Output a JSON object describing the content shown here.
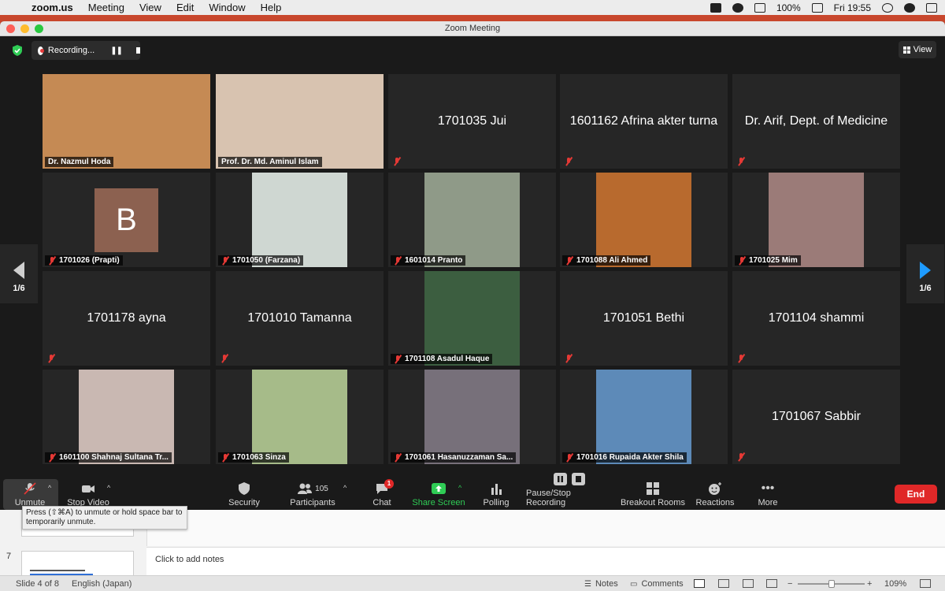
{
  "menubar": {
    "app": "zoom.us",
    "items": [
      "Meeting",
      "View",
      "Edit",
      "Window",
      "Help"
    ],
    "battery": "100%",
    "clock": "Fri 19:55"
  },
  "window": {
    "title": "Zoom Meeting"
  },
  "recording": {
    "label": "Recording..."
  },
  "view_button": {
    "label": "View"
  },
  "pager": {
    "left": "1/6",
    "right": "1/6"
  },
  "participants": [
    {
      "name": "Dr. Nazmul Hoda",
      "video": true,
      "muted": false,
      "active": true,
      "bg": "#c58a54"
    },
    {
      "name": "Prof. Dr. Md. Aminul Islam",
      "video": true,
      "muted": false,
      "bg": "#d8c3b0"
    },
    {
      "name": "1701035 Jui",
      "video": false,
      "muted": true
    },
    {
      "name": "1601162 Afrina akter turna",
      "video": false,
      "muted": true
    },
    {
      "name": "Dr. Arif, Dept. of Medicine",
      "video": false,
      "muted": true
    },
    {
      "name": "1701026 (Prapti)",
      "avatar": "B",
      "muted": true
    },
    {
      "name": "1701050 (Farzana)",
      "photo": true,
      "muted": true,
      "bg": "#cfd7d2"
    },
    {
      "name": "1601014 Pranto",
      "photo": true,
      "muted": true,
      "bg": "#8f9a88"
    },
    {
      "name": "1701088 Ali Ahmed",
      "photo": true,
      "muted": true,
      "bg": "#b86a2e"
    },
    {
      "name": "1701025 Mim",
      "photo": true,
      "muted": true,
      "bg": "#9b7b78"
    },
    {
      "name": "1701178 ayna",
      "video": false,
      "muted": true
    },
    {
      "name": "1701010 Tamanna",
      "video": false,
      "muted": true
    },
    {
      "name": "1701108 Asadul Haque",
      "photo": true,
      "muted": true,
      "bg": "#3c5e40"
    },
    {
      "name": "1701051 Bethi",
      "video": false,
      "muted": true
    },
    {
      "name": "1701104 shammi",
      "video": false,
      "muted": true
    },
    {
      "name": "1601100 Shahnaj Sultana Tr...",
      "photo": true,
      "muted": true,
      "bg": "#c9b8b2"
    },
    {
      "name": "1701063 Sinza",
      "photo": true,
      "muted": true,
      "bg": "#a6bb89"
    },
    {
      "name": "1701061 Hasanuzzaman Sa...",
      "photo": true,
      "muted": true,
      "bg": "#77707a"
    },
    {
      "name": "1701016 Rupaida Akter Shila",
      "photo": true,
      "muted": true,
      "bg": "#5d8ab8"
    },
    {
      "name": "1701067 Sabbir",
      "video": false,
      "muted": true
    }
  ],
  "toolbar": {
    "unmute": "Unmute",
    "stop_video": "Stop Video",
    "security": "Security",
    "participants": "Participants",
    "participants_count": "105",
    "chat": "Chat",
    "chat_badge": "1",
    "share_screen": "Share Screen",
    "polling": "Polling",
    "pause_stop_recording": "Pause/Stop Recording",
    "breakout_rooms": "Breakout Rooms",
    "reactions": "Reactions",
    "more": "More",
    "end": "End"
  },
  "tooltip": {
    "text": "Press  (⇧⌘A) to unmute or hold space bar to temporarily unmute."
  },
  "powerpoint": {
    "slide_number": "7",
    "notes_placeholder": "Click to add notes",
    "status_slide": "Slide 4 of 8",
    "status_language": "English (Japan)",
    "notes_button": "Notes",
    "comments_button": "Comments",
    "zoom_level": "109%"
  },
  "colors": {
    "accent_green": "#2fcc55",
    "end_red": "#e02828",
    "active_speaker": "#d6e04a",
    "mute_red": "#e53935"
  }
}
